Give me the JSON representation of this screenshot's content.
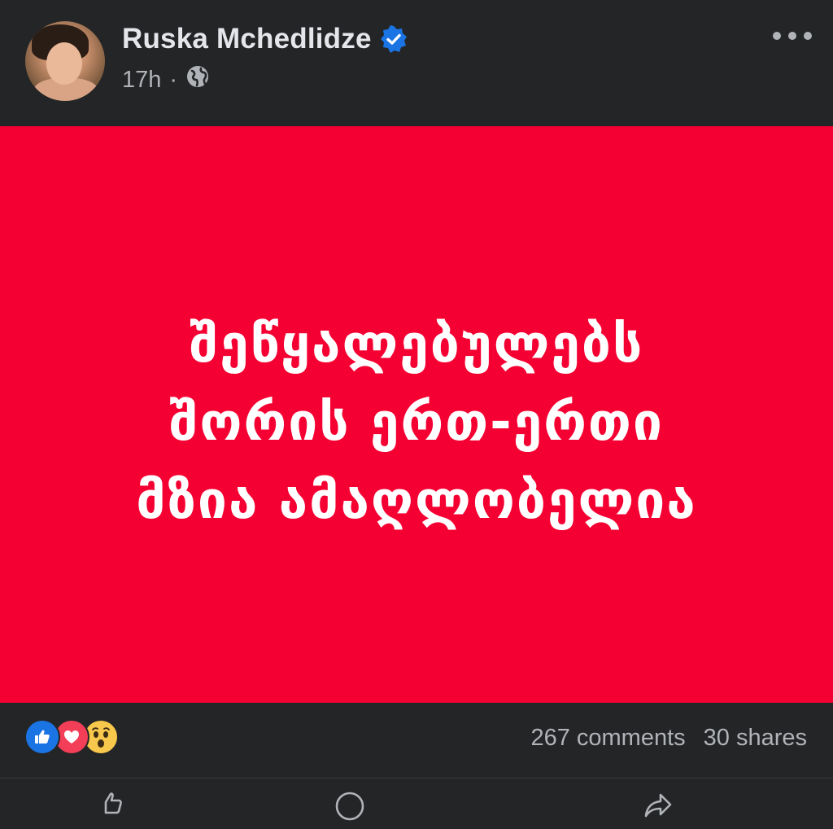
{
  "post": {
    "author": "Ruska Mchedlidze",
    "time": "17h",
    "separator": "·",
    "audience_icon": "globe-icon",
    "verified_icon": "verified-badge-icon",
    "more_icon": "more-options-icon",
    "lines": [
      "შეწყალებულებს",
      "შორის ერთ-ერთი",
      "მზია ამაღლობელია"
    ],
    "background_color": "#f50032"
  },
  "stats": {
    "reactions": [
      "like-reaction-icon",
      "love-reaction-icon",
      "wow-reaction-icon"
    ],
    "comments": "267 comments",
    "shares": "30 shares"
  },
  "actions": {
    "like_icon": "thumbs-up-icon",
    "comment_icon": "comment-icon",
    "share_icon": "share-icon"
  }
}
